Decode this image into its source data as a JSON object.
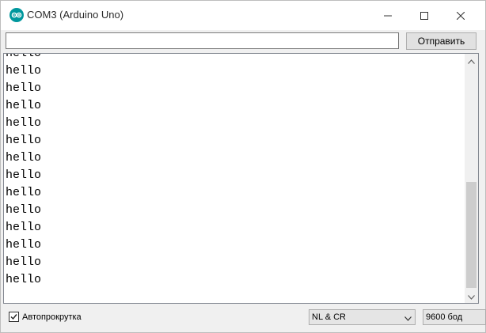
{
  "window": {
    "title": "COM3 (Arduino Uno)",
    "icon": "arduino-icon",
    "accent_color": "#00979d"
  },
  "controls": {
    "minimize_icon": "minimize-icon",
    "maximize_icon": "maximize-icon",
    "close_icon": "close-icon"
  },
  "send": {
    "input_value": "",
    "input_placeholder": "",
    "button_label": "Отправить"
  },
  "output": {
    "lines": [
      "hello",
      "hello",
      "hello",
      "hello",
      "hello",
      "hello",
      "hello",
      "hello",
      "hello",
      "hello",
      "hello",
      "hello",
      "hello",
      "hello"
    ]
  },
  "bottom": {
    "autoscroll_label": "Автопрокрутка",
    "autoscroll_checked": true,
    "line_ending": "NL & CR",
    "baud_rate": "9600 бод"
  }
}
